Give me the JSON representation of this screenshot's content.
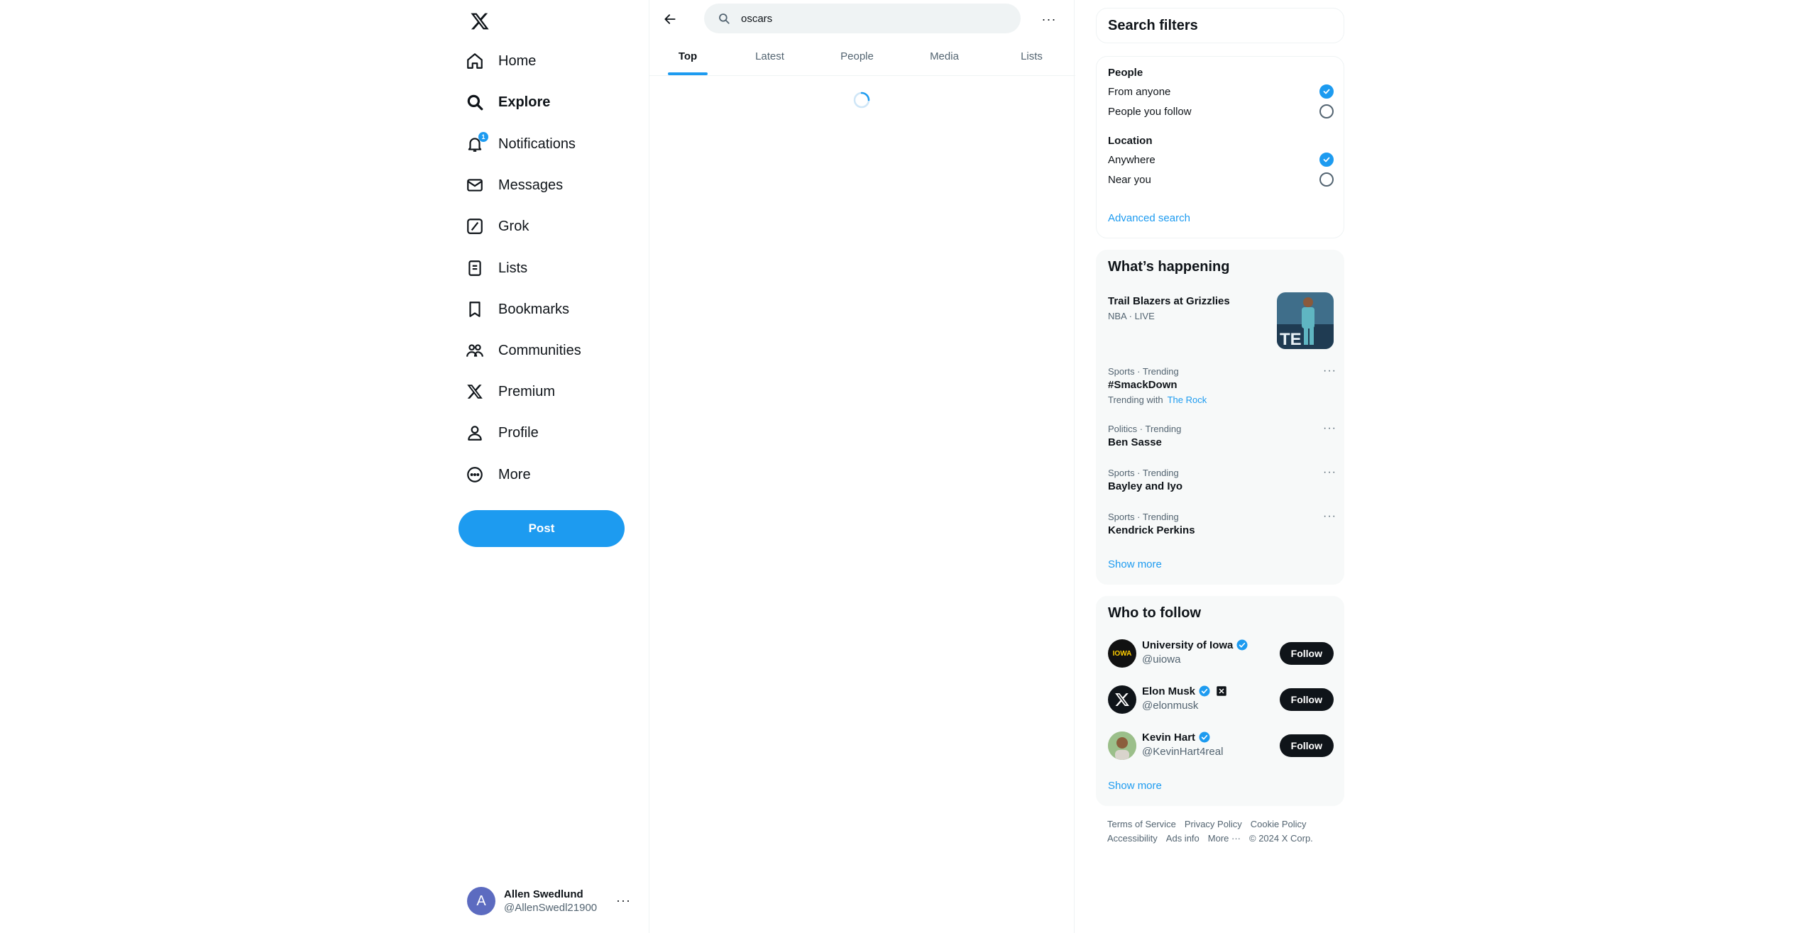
{
  "nav": {
    "items": [
      {
        "label": "Home",
        "icon": "home-icon"
      },
      {
        "label": "Explore",
        "icon": "search-icon"
      },
      {
        "label": "Notifications",
        "icon": "bell-icon",
        "badge": "1"
      },
      {
        "label": "Messages",
        "icon": "envelope-icon"
      },
      {
        "label": "Grok",
        "icon": "grok-icon"
      },
      {
        "label": "Lists",
        "icon": "list-icon"
      },
      {
        "label": "Bookmarks",
        "icon": "bookmark-icon"
      },
      {
        "label": "Communities",
        "icon": "people-icon"
      },
      {
        "label": "Premium",
        "icon": "x-logo-icon"
      },
      {
        "label": "Profile",
        "icon": "person-icon"
      },
      {
        "label": "More",
        "icon": "more-circle-icon"
      }
    ],
    "post_label": "Post",
    "account": {
      "avatar_letter": "A",
      "name": "Allen Swedlund",
      "handle": "@AllenSwedl21900"
    }
  },
  "search": {
    "value": "oscars"
  },
  "tabs": [
    "Top",
    "Latest",
    "People",
    "Media",
    "Lists"
  ],
  "filters": {
    "title": "Search filters",
    "people_heading": "People",
    "people_options": [
      {
        "label": "From anyone",
        "checked": true
      },
      {
        "label": "People you follow",
        "checked": false
      }
    ],
    "location_heading": "Location",
    "location_options": [
      {
        "label": "Anywhere",
        "checked": true
      },
      {
        "label": "Near you",
        "checked": false
      }
    ],
    "advanced_label": "Advanced search"
  },
  "happening": {
    "title": "What’s happening",
    "featured": {
      "name": "Trail Blazers at Grizzlies",
      "meta": "NBA · LIVE"
    },
    "trends": [
      {
        "meta": "Sports · Trending",
        "name": "#SmackDown",
        "with_label": "Trending with",
        "with_value": "The Rock"
      },
      {
        "meta": "Politics · Trending",
        "name": "Ben Sasse"
      },
      {
        "meta": "Sports · Trending",
        "name": "Bayley and Iyo"
      },
      {
        "meta": "Sports · Trending",
        "name": "Kendrick Perkins"
      }
    ],
    "show_more": "Show more"
  },
  "who_to_follow": {
    "title": "Who to follow",
    "accounts": [
      {
        "name": "University of Iowa",
        "handle": "@uiowa",
        "avatar_text": "IOWA"
      },
      {
        "name": "Elon Musk",
        "handle": "@elonmusk"
      },
      {
        "name": "Kevin Hart",
        "handle": "@KevinHart4real"
      }
    ],
    "follow_label": "Follow",
    "show_more": "Show more"
  },
  "footer": {
    "line1": [
      "Terms of Service",
      "Privacy Policy",
      "Cookie Policy"
    ],
    "line2": [
      "Accessibility",
      "Ads info",
      "More ···",
      "© 2024 X Corp."
    ]
  },
  "colors": {
    "accent": "#1d9bf0",
    "text": "#0f1419",
    "muted": "#536471"
  }
}
